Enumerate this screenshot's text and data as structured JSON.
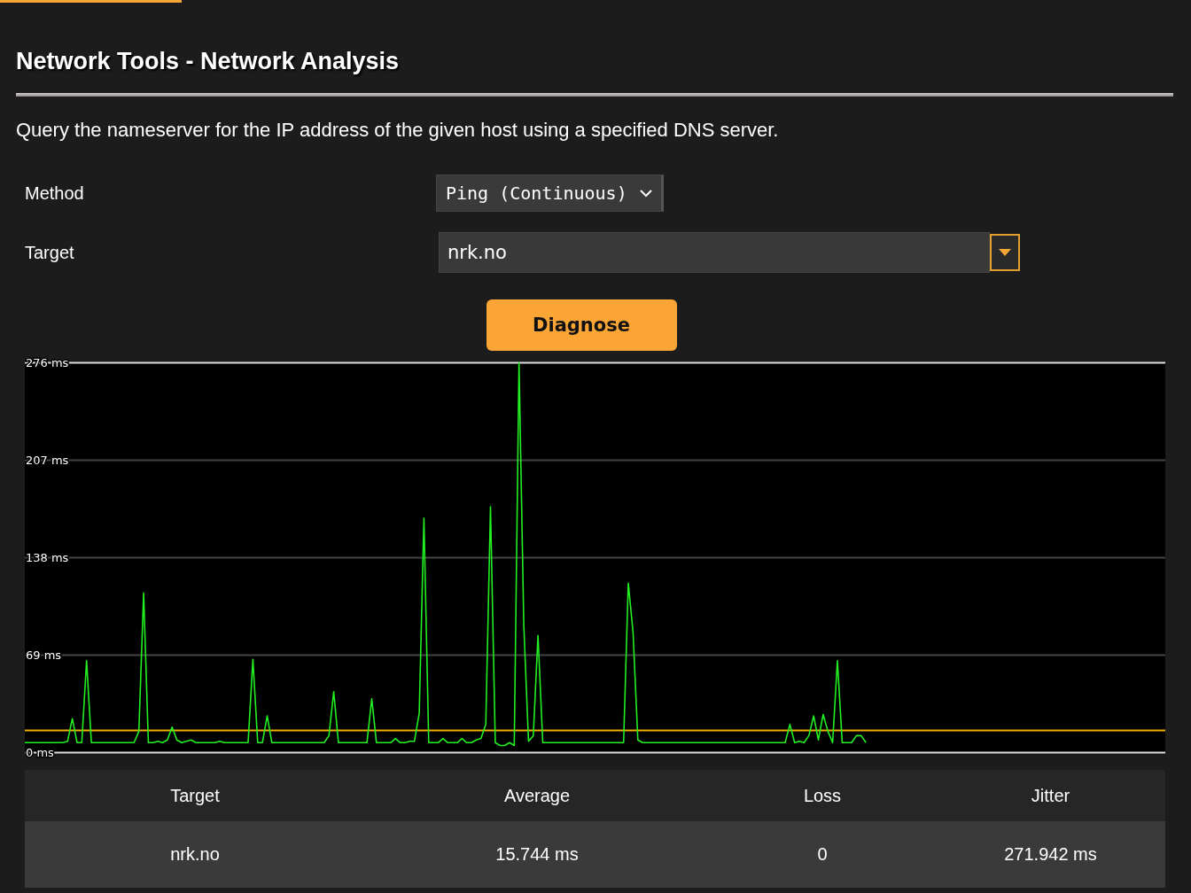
{
  "page": {
    "title": "Network Tools - Network Analysis",
    "description": "Query the nameserver for the IP address of the given host using a specified DNS server."
  },
  "form": {
    "method": {
      "label": "Method",
      "value": "Ping (Continuous)"
    },
    "target": {
      "label": "Target",
      "value": "nrk.no"
    },
    "submit": "Diagnose"
  },
  "chart": {
    "chart_data": {
      "type": "line",
      "ylim": [
        0,
        276
      ],
      "yticks": [
        {
          "value": 0,
          "label": "0 ms"
        },
        {
          "value": 69,
          "label": "69 ms"
        },
        {
          "value": 138,
          "label": "138 ms"
        },
        {
          "value": 207,
          "label": "207 ms"
        },
        {
          "value": 276,
          "label": "276 ms"
        }
      ],
      "series": [
        {
          "color": "#22ee22",
          "values": [
            7,
            7,
            7,
            7,
            7,
            7,
            7,
            7,
            7,
            8,
            24,
            7,
            7,
            65,
            7,
            7,
            7,
            7,
            7,
            7,
            7,
            7,
            7,
            7,
            15,
            113,
            7,
            7,
            8,
            7,
            9,
            18,
            9,
            7,
            8,
            9,
            7,
            7,
            7,
            7,
            7,
            8,
            7,
            7,
            7,
            7,
            7,
            7,
            66,
            7,
            7,
            26,
            7,
            7,
            7,
            7,
            7,
            7,
            7,
            7,
            7,
            7,
            7,
            7,
            12,
            43,
            7,
            7,
            7,
            7,
            7,
            7,
            7,
            38,
            7,
            7,
            7,
            7,
            10,
            7,
            7,
            8,
            8,
            28,
            166,
            7,
            7,
            7,
            10,
            7,
            7,
            7,
            10,
            7,
            7,
            9,
            10,
            20,
            174,
            7,
            5,
            5,
            7,
            5,
            276,
            90,
            8,
            12,
            83,
            7,
            7,
            7,
            7,
            7,
            7,
            7,
            7,
            7,
            7,
            7,
            7,
            7,
            7,
            7,
            7,
            7,
            7,
            120,
            85,
            9,
            7,
            7,
            7,
            7,
            7,
            7,
            7,
            7,
            7,
            7,
            7,
            7,
            7,
            7,
            7,
            7,
            7,
            7,
            7,
            7,
            7,
            7,
            7,
            7,
            7,
            7,
            7,
            7,
            7,
            7,
            7,
            20,
            7,
            8,
            7,
            12,
            26,
            9,
            27,
            15,
            7,
            65,
            7,
            7,
            7,
            12,
            12,
            7
          ]
        }
      ],
      "grid": true,
      "ref_lines": [
        {
          "axis": "y",
          "value": 15.744,
          "color": "#f0b000"
        }
      ]
    }
  },
  "results": {
    "columns": [
      "Target",
      "Average",
      "Loss",
      "Jitter"
    ],
    "rows": [
      [
        "nrk.no",
        "15.744 ms",
        "0",
        "271.942 ms"
      ]
    ]
  }
}
